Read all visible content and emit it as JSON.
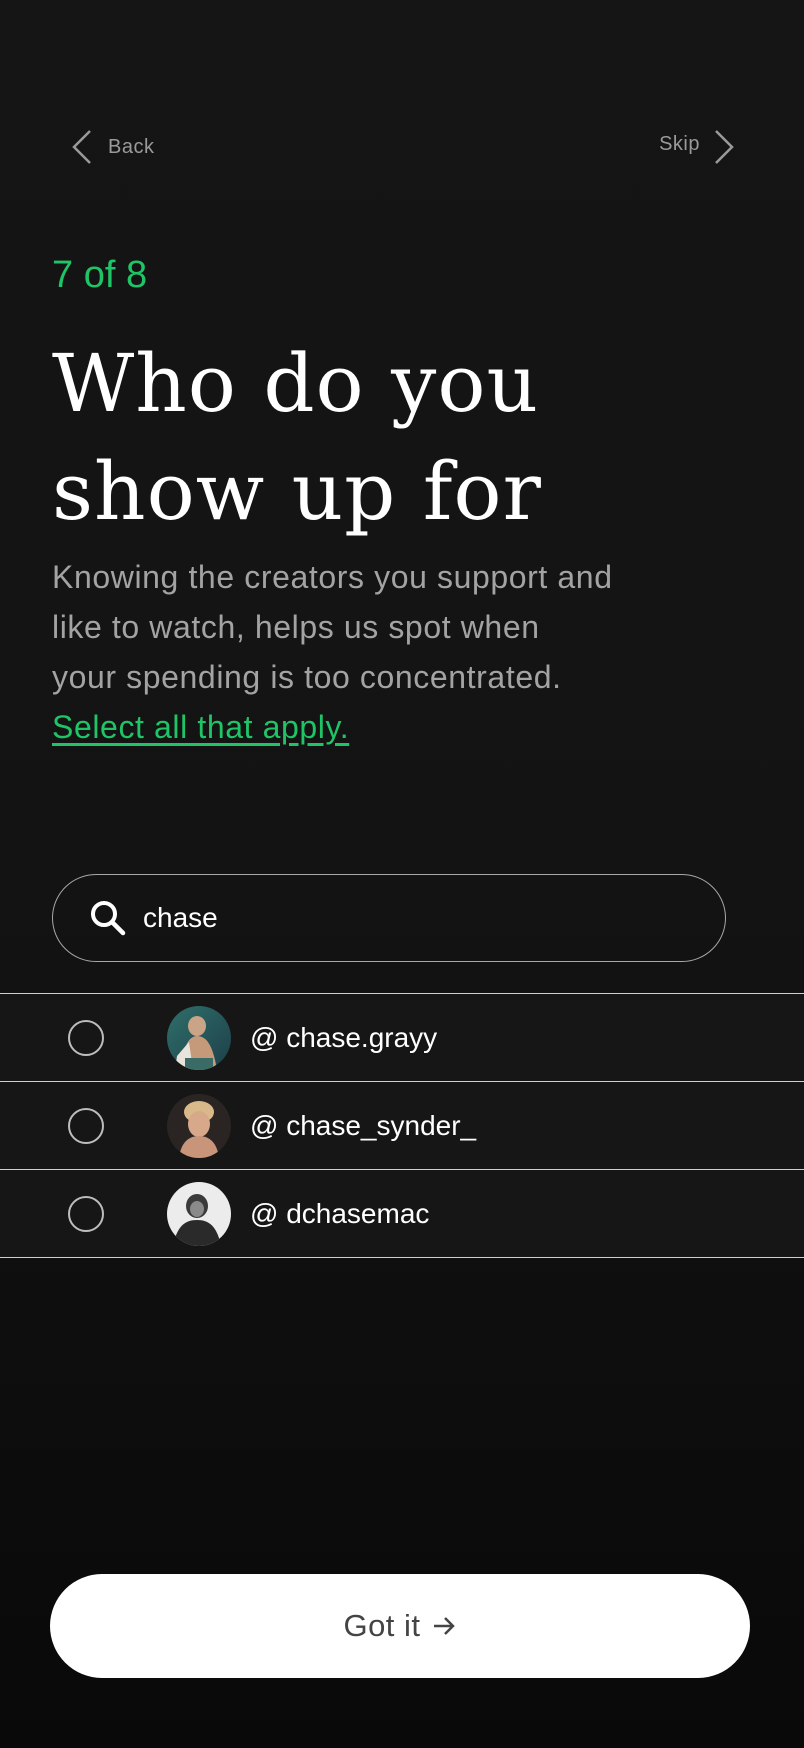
{
  "nav": {
    "back_label": "Back",
    "skip_label": "Skip"
  },
  "header": {
    "step": "7 of 8",
    "title_line1": "Who do you",
    "title_line2": "show up for",
    "desc_line1": "Knowing the creators you support and",
    "desc_line2": "like to watch, helps us spot when",
    "desc_line3": "your spending is too concentrated.",
    "select_all_link": "Select all that apply."
  },
  "search": {
    "value": "chase",
    "icon": "search-icon"
  },
  "results": [
    {
      "handle": "@ chase.grayy",
      "selected": false
    },
    {
      "handle": "@ chase_synder_",
      "selected": false
    },
    {
      "handle": "@ dchasemac",
      "selected": false
    }
  ],
  "cta": {
    "label": "Got it",
    "icon": "arrow-right-icon"
  },
  "colors": {
    "accent": "#1fc466",
    "background": "#141414",
    "button": "#ffffff"
  }
}
